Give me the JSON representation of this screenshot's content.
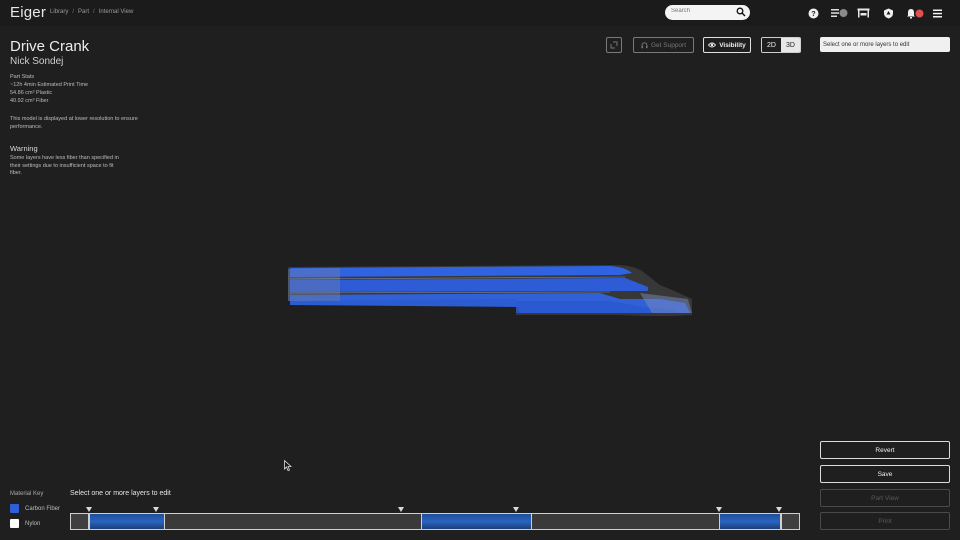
{
  "app": {
    "name": "Eiger"
  },
  "breadcrumb": [
    "Library",
    "Part",
    "Internal View"
  ],
  "search": {
    "placeholder": "Search"
  },
  "part": {
    "title": "Drive Crank",
    "author": "Nick Sondej",
    "stats_heading": "Part Stats",
    "print_time": "~12h 4min Estimated Print Time",
    "plastic": "54.86 cm³ Plastic",
    "fiber": "40.92 cm³ Fiber",
    "note": "This model is displayed at lower resolution to ensure performance.",
    "warning_title": "Warning",
    "warning_text": "Some layers have less fiber than specified in their settings due to insufficient space to fit fiber."
  },
  "toolbar": {
    "support_label": "Get Support",
    "visibility_label": "Visibility",
    "mode_2d": "2D",
    "mode_3d": "3D",
    "layer_select_label": "Select one or more layers to edit"
  },
  "actions": {
    "revert": "Revert",
    "save": "Save",
    "part_view": "Part View",
    "print": "Print"
  },
  "material_key": {
    "label": "Material Key",
    "items": [
      {
        "name": "Carbon Fiber",
        "color": "#2f5fd8"
      },
      {
        "name": "Nylon",
        "color": "#ffffff"
      }
    ]
  },
  "timeline": {
    "label": "Select one or more layers to edit",
    "fiber_ranges": [
      [
        0.0,
        0.11
      ],
      [
        0.48,
        0.64
      ],
      [
        0.91,
        1.0
      ]
    ]
  },
  "colors": {
    "background": "#1f1f1f",
    "fiber_blue": "#2f6bff",
    "nylon_grey": "#8a8a8a"
  }
}
